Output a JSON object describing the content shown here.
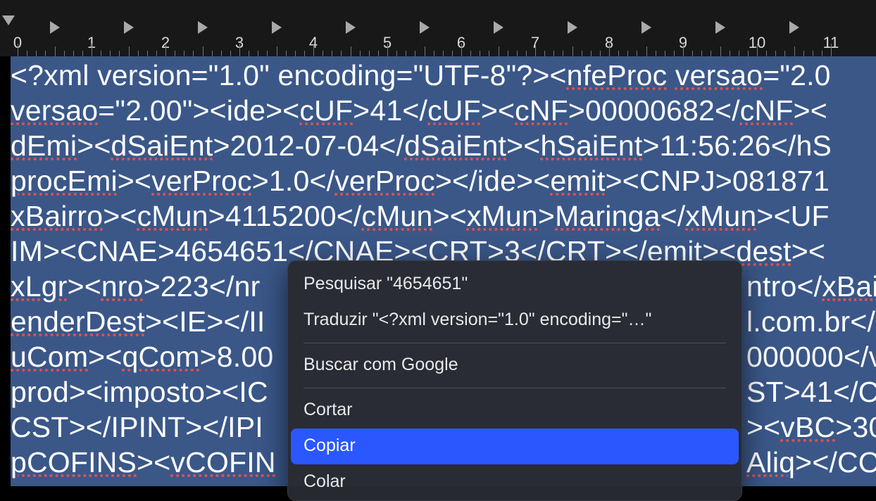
{
  "ruler": {
    "numbers": [
      "0",
      "1",
      "2",
      "3",
      "4",
      "5",
      "6",
      "7",
      "8",
      "9",
      "10",
      "11"
    ]
  },
  "document": {
    "lines": [
      {
        "html": "&lt;?xml version=\"1.0\" encoding=\"UTF-8\"?&gt;&lt;<span class=sp>nfeProc</span> <span class=sp>versao</span>=\"2.0"
      },
      {
        "html": "<span class=sp>versao</span>=\"2.00\"&gt;&lt;ide&gt;&lt;<span class=sp>cUF</span>&gt;41&lt;/<span class=sp>cUF</span>&gt;&lt;<span class=sp>cNF</span>&gt;00000682&lt;/<span class=sp>cNF</span>&gt;&lt;"
      },
      {
        "html": "<span class=sp>dEmi</span>&gt;&lt;<span class=sp>dSaiEnt</span>&gt;2012-07-04&lt;/<span class=sp>dSaiEnt</span>&gt;&lt;<span class=sp>hSaiEnt</span>&gt;11:56:26&lt;/hS"
      },
      {
        "html": "<span class=sp>procEmi</span>&gt;&lt;<span class=sp>verProc</span>&gt;1.0&lt;/<span class=sp>verProc</span>&gt;&lt;/ide&gt;&lt;<span class=sp>emit</span>&gt;&lt;CNPJ&gt;081871"
      },
      {
        "html": "<span class=sp>xBairro</span>&gt;&lt;<span class=sp>cMun</span>&gt;4115200&lt;/<span class=sp>cMun</span>&gt;&lt;<span class=sp>xMun</span>&gt;<span class=sp>Maringa</span>&lt;/<span class=sp>xMun</span>&gt;&lt;UF"
      },
      {
        "html": "IM&gt;&lt;CNAE&gt;4654651&lt;/CNAE&gt;&lt;CRT&gt;3&lt;/CRT&gt;&lt;/<span class=sp>emit</span>&gt;&lt;<span class=sp>dest</span>&gt;&lt;"
      },
      {
        "partsLeft": "<span class=sp>xLgr</span>&gt;&lt;<span class=sp>nro</span>&gt;223&lt;/nr",
        "partsRight": "ntro&lt;/<span class=sp>xBai</span>"
      },
      {
        "partsLeft": "<span class=sp>enderDest</span>&gt;&lt;IE&gt;&lt;/II",
        "partsRight": "l.com.br&lt;/"
      },
      {
        "partsLeft": "<span class=sp>uCom</span>&gt;&lt;<span class=sp>qCom</span>&gt;8.00",
        "partsRight": "000000&lt;/v"
      },
      {
        "partsLeft": "prod&gt;&lt;imposto&gt;&lt;IC",
        "partsRight": "ST&gt;41&lt;/C"
      },
      {
        "partsLeft": "CST&gt;&lt;/IPINT&gt;&lt;/IPI",
        "partsRight": "&gt;&lt;<span class=sp>vBC</span>&gt;30"
      },
      {
        "partsLeft": "<span class=sp>pCOFINS</span>&gt;&lt;<span class=sp>vCOFIN</span>",
        "partsRight": "<span class=sp>Aliq</span>&gt;&lt;/CO"
      }
    ]
  },
  "contextMenu": {
    "search": "Pesquisar \"4654651\"",
    "translate": "Traduzir \"<?xml version=\"1.0\" encoding=\"…\"",
    "google": "Buscar com Google",
    "cut": "Cortar",
    "copy": "Copiar",
    "paste": "Colar"
  }
}
